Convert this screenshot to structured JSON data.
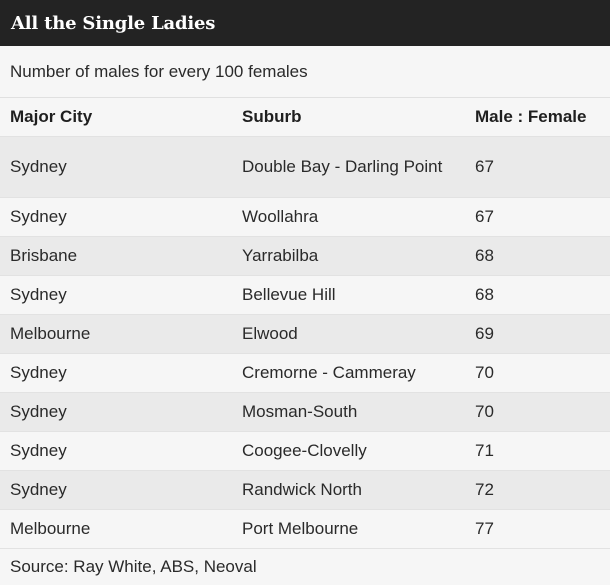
{
  "header": {
    "title": "All the Single Ladies",
    "subtitle": "Number of males for every 100 females"
  },
  "colors": {
    "title_bar": "#232323",
    "title_text": "#ffffff",
    "row_shaded": "#eaeaea",
    "row_plain": "#f6f6f6"
  },
  "chart_data": {
    "type": "table",
    "title": "All the Single Ladies",
    "subtitle": "Number of males for every 100 females",
    "columns": [
      "Major City",
      "Suburb",
      "Male : Female"
    ],
    "rows": [
      [
        "Sydney",
        "Double Bay - Darling Point",
        "67"
      ],
      [
        "Sydney",
        "Woollahra",
        "67"
      ],
      [
        "Brisbane",
        "Yarrabilba",
        "68"
      ],
      [
        "Sydney",
        "Bellevue Hill",
        "68"
      ],
      [
        "Melbourne",
        "Elwood",
        "69"
      ],
      [
        "Sydney",
        "Cremorne - Cammeray",
        "70"
      ],
      [
        "Sydney",
        "Mosman-South",
        "70"
      ],
      [
        "Sydney",
        "Coogee-Clovelly",
        "71"
      ],
      [
        "Sydney",
        "Randwick North",
        "72"
      ],
      [
        "Melbourne",
        "Port Melbourne",
        "77"
      ]
    ],
    "source": "Source: Ray White, ABS, Neoval"
  }
}
